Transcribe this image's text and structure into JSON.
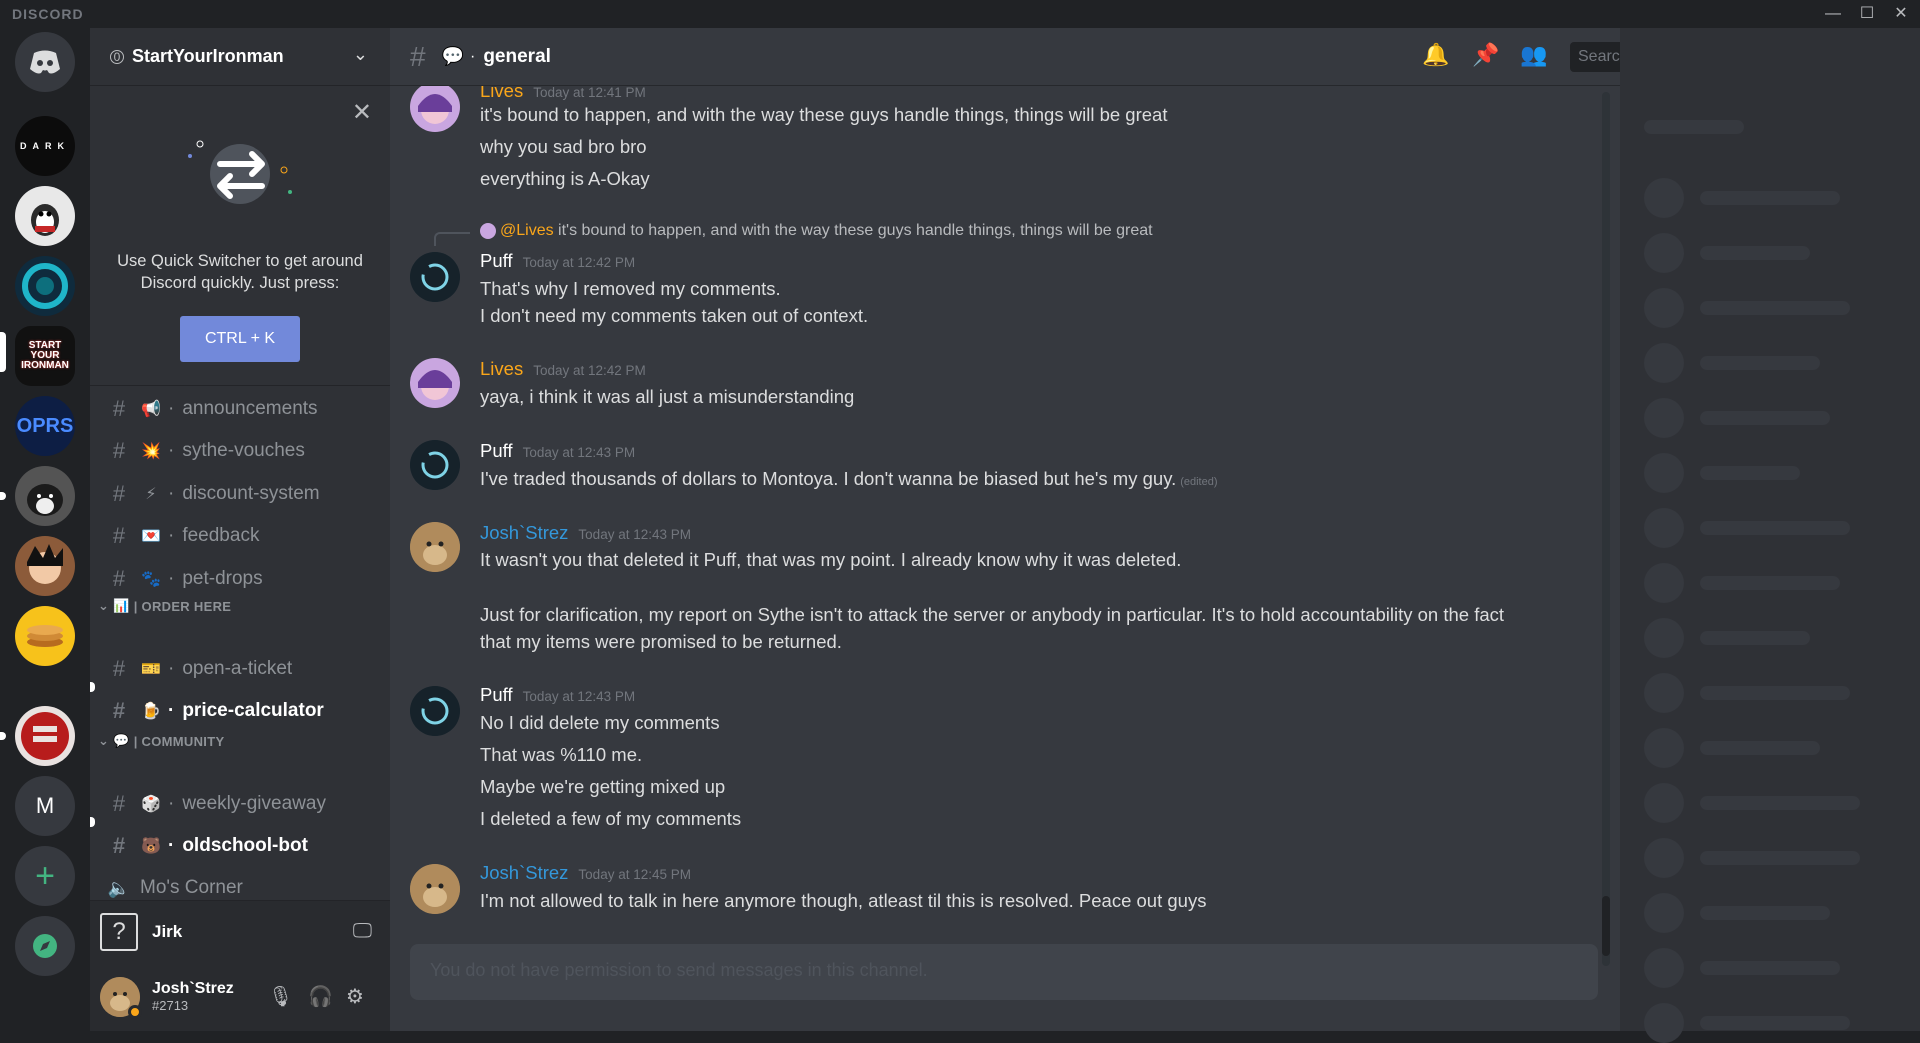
{
  "app": {
    "brand": "DISCORD"
  },
  "window_controls": [
    "—",
    "☐",
    "✕"
  ],
  "server": {
    "name": "StartYourIronman",
    "badge": "0"
  },
  "quick_switcher": {
    "text": "Use Quick Switcher to get around Discord quickly. Just press:",
    "button": "CTRL + K"
  },
  "channels": [
    {
      "emoji": "📢",
      "name": "announcements",
      "bold": false
    },
    {
      "emoji": "💥",
      "name": "sythe-vouches",
      "bold": false
    },
    {
      "emoji": "⚡",
      "name": "discount-system",
      "bold": false
    },
    {
      "emoji": "💌",
      "name": "feedback",
      "bold": false
    },
    {
      "emoji": "🐾",
      "name": "pet-drops",
      "bold": false
    }
  ],
  "categories": {
    "order": {
      "emoji": "📊",
      "label": "| ORDER HERE"
    },
    "community": {
      "emoji": "💬",
      "label": "| COMMUNITY"
    }
  },
  "order_channels": [
    {
      "emoji": "🎫",
      "name": "open-a-ticket",
      "bold": false
    },
    {
      "emoji": "🍺",
      "name": "price-calculator",
      "bold": true
    }
  ],
  "community_channels": [
    {
      "emoji": "🎲",
      "name": "weekly-giveaway",
      "bold": false
    },
    {
      "emoji": "🐻",
      "name": "oldschool-bot",
      "bold": true
    }
  ],
  "voice_channel": "Mo's Corner",
  "voice_user": "Jirk",
  "user": {
    "name": "Josh`Strez",
    "tag": "#2713"
  },
  "chat_header": {
    "channel": "general",
    "emoji": "💬",
    "search_placeholder": "Search"
  },
  "colors": {
    "lives": "#faa61a",
    "puff": "#ffffff",
    "josh": "#3498db"
  },
  "messages": [
    {
      "author": "Lives",
      "time": "Today at 12:41 PM",
      "lines": [
        "it's bound to happen, and with the way these guys handle things, things will be great",
        "why you sad bro bro",
        "everything is A-Okay"
      ]
    },
    {
      "reply_mention": "@Lives",
      "reply_text": "it's bound to happen, and with the way these guys handle things, things will be great",
      "author": "Puff",
      "time": "Today at 12:42 PM",
      "lines": [
        "That's why I removed my comments.",
        "I don't need my comments taken out of context."
      ]
    },
    {
      "author": "Lives",
      "time": "Today at 12:42 PM",
      "lines": [
        "yaya, i think it was all just a misunderstanding"
      ]
    },
    {
      "author": "Puff",
      "time": "Today at 12:43 PM",
      "lines": [
        "I've traded thousands of dollars to Montoya. I don't wanna be biased but he's my guy."
      ],
      "edited": "(edited)"
    },
    {
      "author": "Josh`Strez",
      "time": "Today at 12:43 PM",
      "lines": [
        "It wasn't you that deleted it Puff, that was my point. I already know why it was deleted.",
        "Just for clarification, my report on Sythe isn't to attack the server or anybody in particular. It's to hold accountability on the fact",
        "that my items were promised to be returned."
      ]
    },
    {
      "author": "Puff",
      "time": "Today at 12:43 PM",
      "lines": [
        "No I did delete my comments",
        "That was %110 me.",
        "Maybe we're getting mixed up",
        "I deleted a few of my comments"
      ]
    },
    {
      "author": "Josh`Strez",
      "time": "Today at 12:45 PM",
      "lines": [
        "I'm not allowed to talk in here anymore though, atleast til this is resolved. Peace out guys"
      ]
    }
  ],
  "composer_placeholder": "You do not have permission to send messages in this channel.",
  "server_rail": [
    {
      "label": "DARK"
    },
    {
      "label": "START YOUR IRONMAN"
    },
    {
      "label": "OPRS"
    },
    {
      "label": "M"
    }
  ]
}
